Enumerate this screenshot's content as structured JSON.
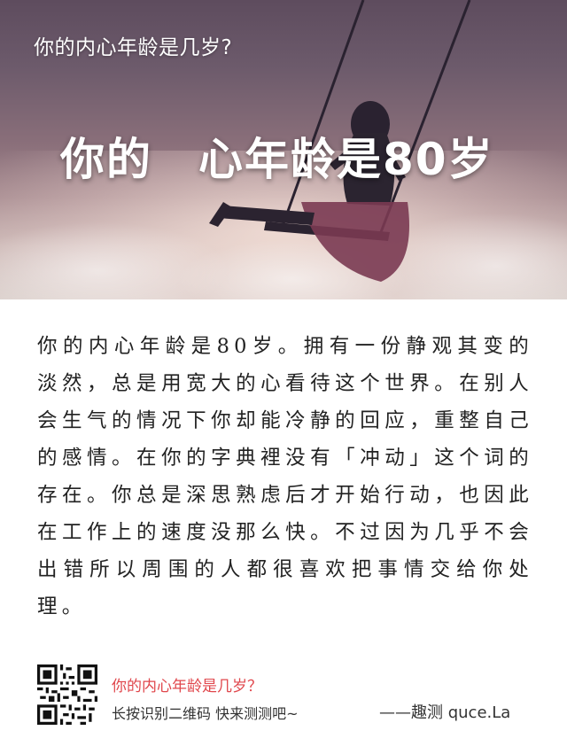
{
  "hero": {
    "small_title": "你的内心年龄是几岁?",
    "big_title": "你的　心年龄是80岁"
  },
  "result": {
    "text": "你的内心年龄是80岁。拥有一份静观其变的淡然，总是用宽大的心看待这个世界。在别人会生气的情况下你却能冷静的回应，重整自己的感情。在你的字典裡没有「冲动」这个词的存在。你总是深思熟虑后才开始行动，也因此在工作上的速度没那么快。不过因为几乎不会出错所以周围的人都很喜欢把事情交给你处理。"
  },
  "footer": {
    "question": "你的内心年龄是几岁？",
    "hint": "长按识别二维码  快来测测吧~",
    "brand": "——趣测 quce.La"
  },
  "colors": {
    "accent": "#e0474c",
    "text": "#222222"
  }
}
